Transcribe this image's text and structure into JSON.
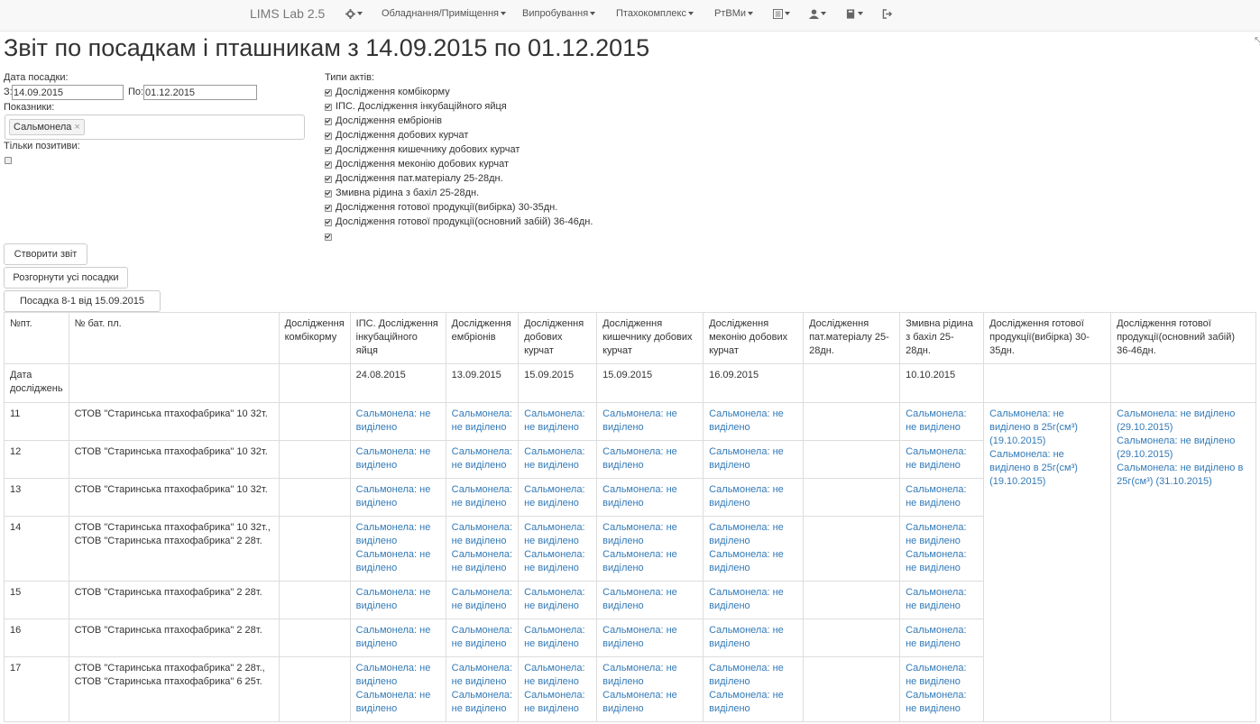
{
  "navbar": {
    "brand": "LIMS Lab 2.5",
    "menus": [
      "Обладнання/Приміщення",
      "Випробування",
      "Птахокомплекс",
      "РтВМи"
    ],
    "icons": [
      "gear-icon",
      "list-icon",
      "user-icon",
      "book-icon",
      "logout-icon"
    ]
  },
  "page": {
    "title": "Звіт по посадкам і пташникам з 14.09.2015 по 01.12.2015"
  },
  "form": {
    "date_label": "Дата посадки:",
    "from_label": "З:",
    "from_value": "14.09.2015",
    "to_label": "По:",
    "to_value": "01.12.2015",
    "indicators_label": "Показники:",
    "indicator_tag": "Сальмонела",
    "indicator_remove": "×",
    "positives_label": "Тільки позитиви:",
    "act_types_label": "Типи актів:",
    "act_types": [
      "Дослідження комбікорму",
      "ІПС. Дослідження інкубаційного яйця",
      "Дослідження ембріонів",
      "Дослідження добових курчат",
      "Дослідження кишечнику добових курчат",
      "Дослідження меконію добових курчат",
      "Дослідження пат.матеріалу 25-28дн.",
      "Змивна рідина з бахіл 25-28дн.",
      "Дослідження готової продукції(вибірка) 30-35дн.",
      "Дослідження готової продукції(основний забій) 36-46дн.",
      ""
    ]
  },
  "buttons": {
    "create_report": "Створити звіт",
    "expand_all": "Розгорнути усі посадки",
    "landing": "Посадка 8-1 від 15.09.2015"
  },
  "table": {
    "headers": [
      "№пт.",
      "№ бат. пл.",
      "Дослідження комбікорму",
      "ІПС. Дослідження інкубаційного яйця",
      "Дослідження ембріонів",
      "Дослідження добових курчат",
      "Дослідження кишечнику добових курчат",
      "Дослідження меконію добових курчат",
      "Дослідження пат.матеріалу 25-28дн.",
      "Змивна рідина з бахіл 25-28дн.",
      "Дослідження готової продукції(вибірка) 30-35дн.",
      "Дослідження готової продукції(основний забій) 36-46дн."
    ],
    "date_row": {
      "label": "Дата досліджень",
      "dates": [
        "",
        "",
        "24.08.2015",
        "13.09.2015",
        "15.09.2015",
        "15.09.2015",
        "16.09.2015",
        "",
        "10.10.2015",
        "",
        ""
      ]
    },
    "result_text": "Сальмонела: не виділено",
    "rows": [
      {
        "num": "11",
        "parent": "СТОВ \"Старинська птахофабрика\" 10 32т."
      },
      {
        "num": "12",
        "parent": "СТОВ \"Старинська птахофабрика\" 10 32т."
      },
      {
        "num": "13",
        "parent": "СТОВ \"Старинська птахофабрика\" 10 32т."
      },
      {
        "num": "14",
        "parent": "СТОВ \"Старинська птахофабрика\" 10 32т., СТОВ \"Старинська птахофабрика\" 2 28т."
      },
      {
        "num": "15",
        "parent": "СТОВ \"Старинська птахофабрика\" 2 28т."
      },
      {
        "num": "16",
        "parent": "СТОВ \"Старинська птахофабрика\" 2 28т."
      },
      {
        "num": "17",
        "parent": "СТОВ \"Старинська птахофабрика\" 2 28т., СТОВ \"Старинська птахофабрика\" 6 25т."
      }
    ],
    "sample_results": [
      "Сальмонела: не виділено в 25г(см³) (19.10.2015)",
      "Сальмонела: не виділено в 25г(см³) (19.10.2015)"
    ],
    "slaughter_results": [
      "Сальмонела: не виділено (29.10.2015)",
      "Сальмонела: не виділено (29.10.2015)",
      "Сальмонела: не виділено в 25г(см³) (31.10.2015)"
    ]
  }
}
